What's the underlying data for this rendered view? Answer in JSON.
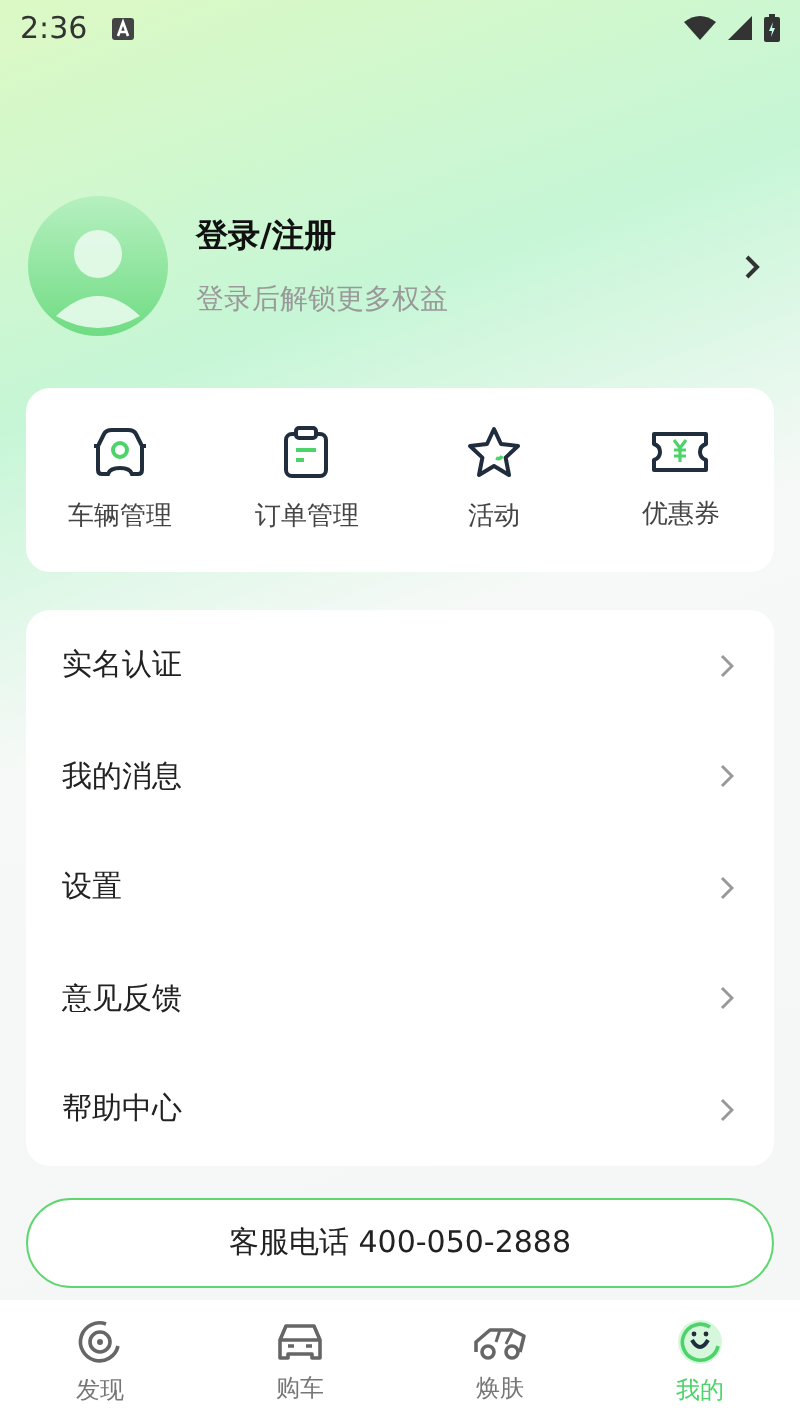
{
  "status_bar": {
    "time": "2:36"
  },
  "profile": {
    "title": "登录/注册",
    "subtitle": "登录后解锁更多权益"
  },
  "quick_actions": [
    {
      "label": "车辆管理"
    },
    {
      "label": "订单管理"
    },
    {
      "label": "活动"
    },
    {
      "label": "优惠券"
    }
  ],
  "menu": [
    {
      "label": "实名认证"
    },
    {
      "label": "我的消息"
    },
    {
      "label": "设置"
    },
    {
      "label": "意见反馈"
    },
    {
      "label": "帮助中心"
    }
  ],
  "hotline_button": "客服电话 400-050-2888",
  "tab_bar": [
    {
      "label": "发现",
      "selected": false
    },
    {
      "label": "购车",
      "selected": false
    },
    {
      "label": "焕肤",
      "selected": false
    },
    {
      "label": "我的",
      "selected": true
    }
  ]
}
